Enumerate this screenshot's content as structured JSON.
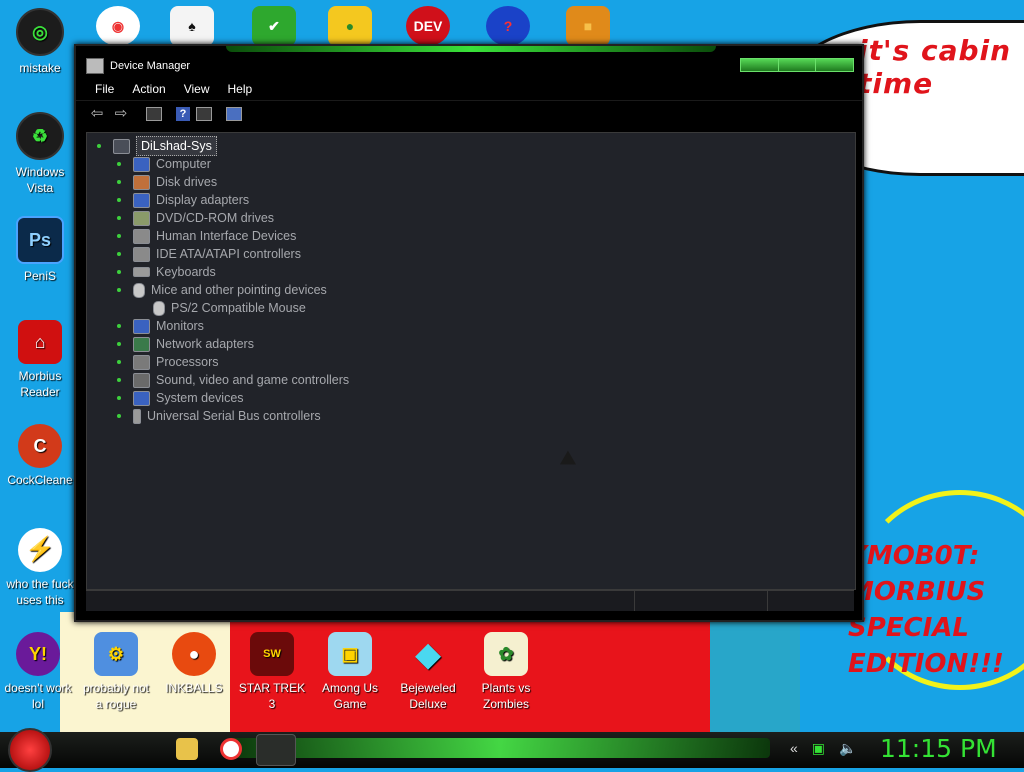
{
  "desktop": {
    "wallpaper_text_top": "it's cabin time",
    "wallpaper_text_bottom": "YMob0t: MORBIUS SPECIAL EDITION!!!",
    "left_icons": [
      {
        "label": "mistake"
      },
      {
        "label": "Windows Vista"
      },
      {
        "label": "PeniS"
      },
      {
        "label": "Morbius Reader"
      },
      {
        "label": "CockCleane"
      },
      {
        "label": "who the fuck uses this"
      }
    ],
    "top_icons": [
      {
        "name": "chrome-icon",
        "glyph": "◉"
      },
      {
        "name": "cards-icon",
        "glyph": "♠"
      },
      {
        "name": "shield-check-icon",
        "glyph": "✔"
      },
      {
        "name": "angry-birds-pig-icon",
        "glyph": "●"
      },
      {
        "name": "dev-cpp-icon",
        "glyph": "DEV"
      },
      {
        "name": "question-swirl-icon",
        "glyph": "?"
      },
      {
        "name": "orange-block-icon",
        "glyph": "■"
      }
    ],
    "bottom_icons": [
      {
        "label": "doesn't work lol"
      },
      {
        "label": "probably not a rogue"
      },
      {
        "label": "INKBALLS"
      },
      {
        "label": "STAR TREK 3"
      },
      {
        "label": "Among Us Game"
      },
      {
        "label": "Bejeweled Deluxe"
      },
      {
        "label": "Plants vs Zombies"
      }
    ]
  },
  "window": {
    "title": "Device Manager",
    "menu": [
      "File",
      "Action",
      "View",
      "Help"
    ],
    "tree": {
      "root": "DiLshad-Sys",
      "categories": [
        "Computer",
        "Disk drives",
        "Display adapters",
        "DVD/CD-ROM drives",
        "Human Interface Devices",
        "IDE ATA/ATAPI controllers",
        "Keyboards",
        "Mice and other pointing devices",
        "PS/2 Compatible Mouse",
        "Monitors",
        "Network adapters",
        "Processors",
        "Sound, video and game controllers",
        "System devices",
        "Universal Serial Bus controllers"
      ]
    }
  },
  "taskbar": {
    "clock": "11:15 PM"
  },
  "colors": {
    "accent_green": "#34e234",
    "window_bg": "#212329",
    "desktop_blue": "#17a3e6"
  }
}
